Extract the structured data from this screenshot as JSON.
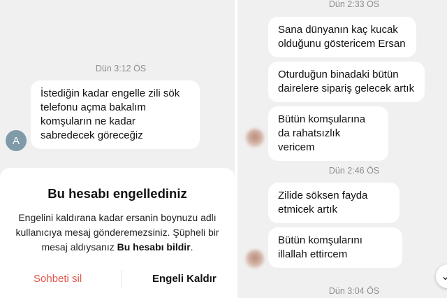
{
  "left_chat": {
    "timestamp": "Dün 3:12 ÖS",
    "avatar_letter": "A",
    "message": "İstediğin kadar engelle zili sök telefonu açma bakalım komşuların ne kadar sabredecek göreceğiz"
  },
  "block_sheet": {
    "title": "Bu hesabı engellediniz",
    "body_prefix": "Engelini kaldırana kadar ersanin boynuzu adlı kullanıcıya mesaj gönderemezsiniz. Şüpheli bir mesaj aldıysanız ",
    "report_link": "Bu hesabı bildir",
    "body_suffix": ".",
    "delete_chat_label": "Sohbeti sil",
    "unblock_label": "Engeli Kaldır"
  },
  "right_chat": {
    "timestamps": [
      "Dün 2:33 ÖS",
      "Dün 2:46 ÖS",
      "Dün 3:04 ÖS"
    ],
    "messages": [
      "Sana dünyanın kaç kucak olduğunu göstericem Ersan",
      "Oturduğun binadaki bütün dairelere sipariş gelecek artık",
      "Bütün komşularına da rahatsızlık vericem",
      "Zilide söksen fayda etmicek artık",
      "Bütün komşularını illallah ettircem"
    ],
    "scroll_icon": "chevron-down-icon"
  }
}
